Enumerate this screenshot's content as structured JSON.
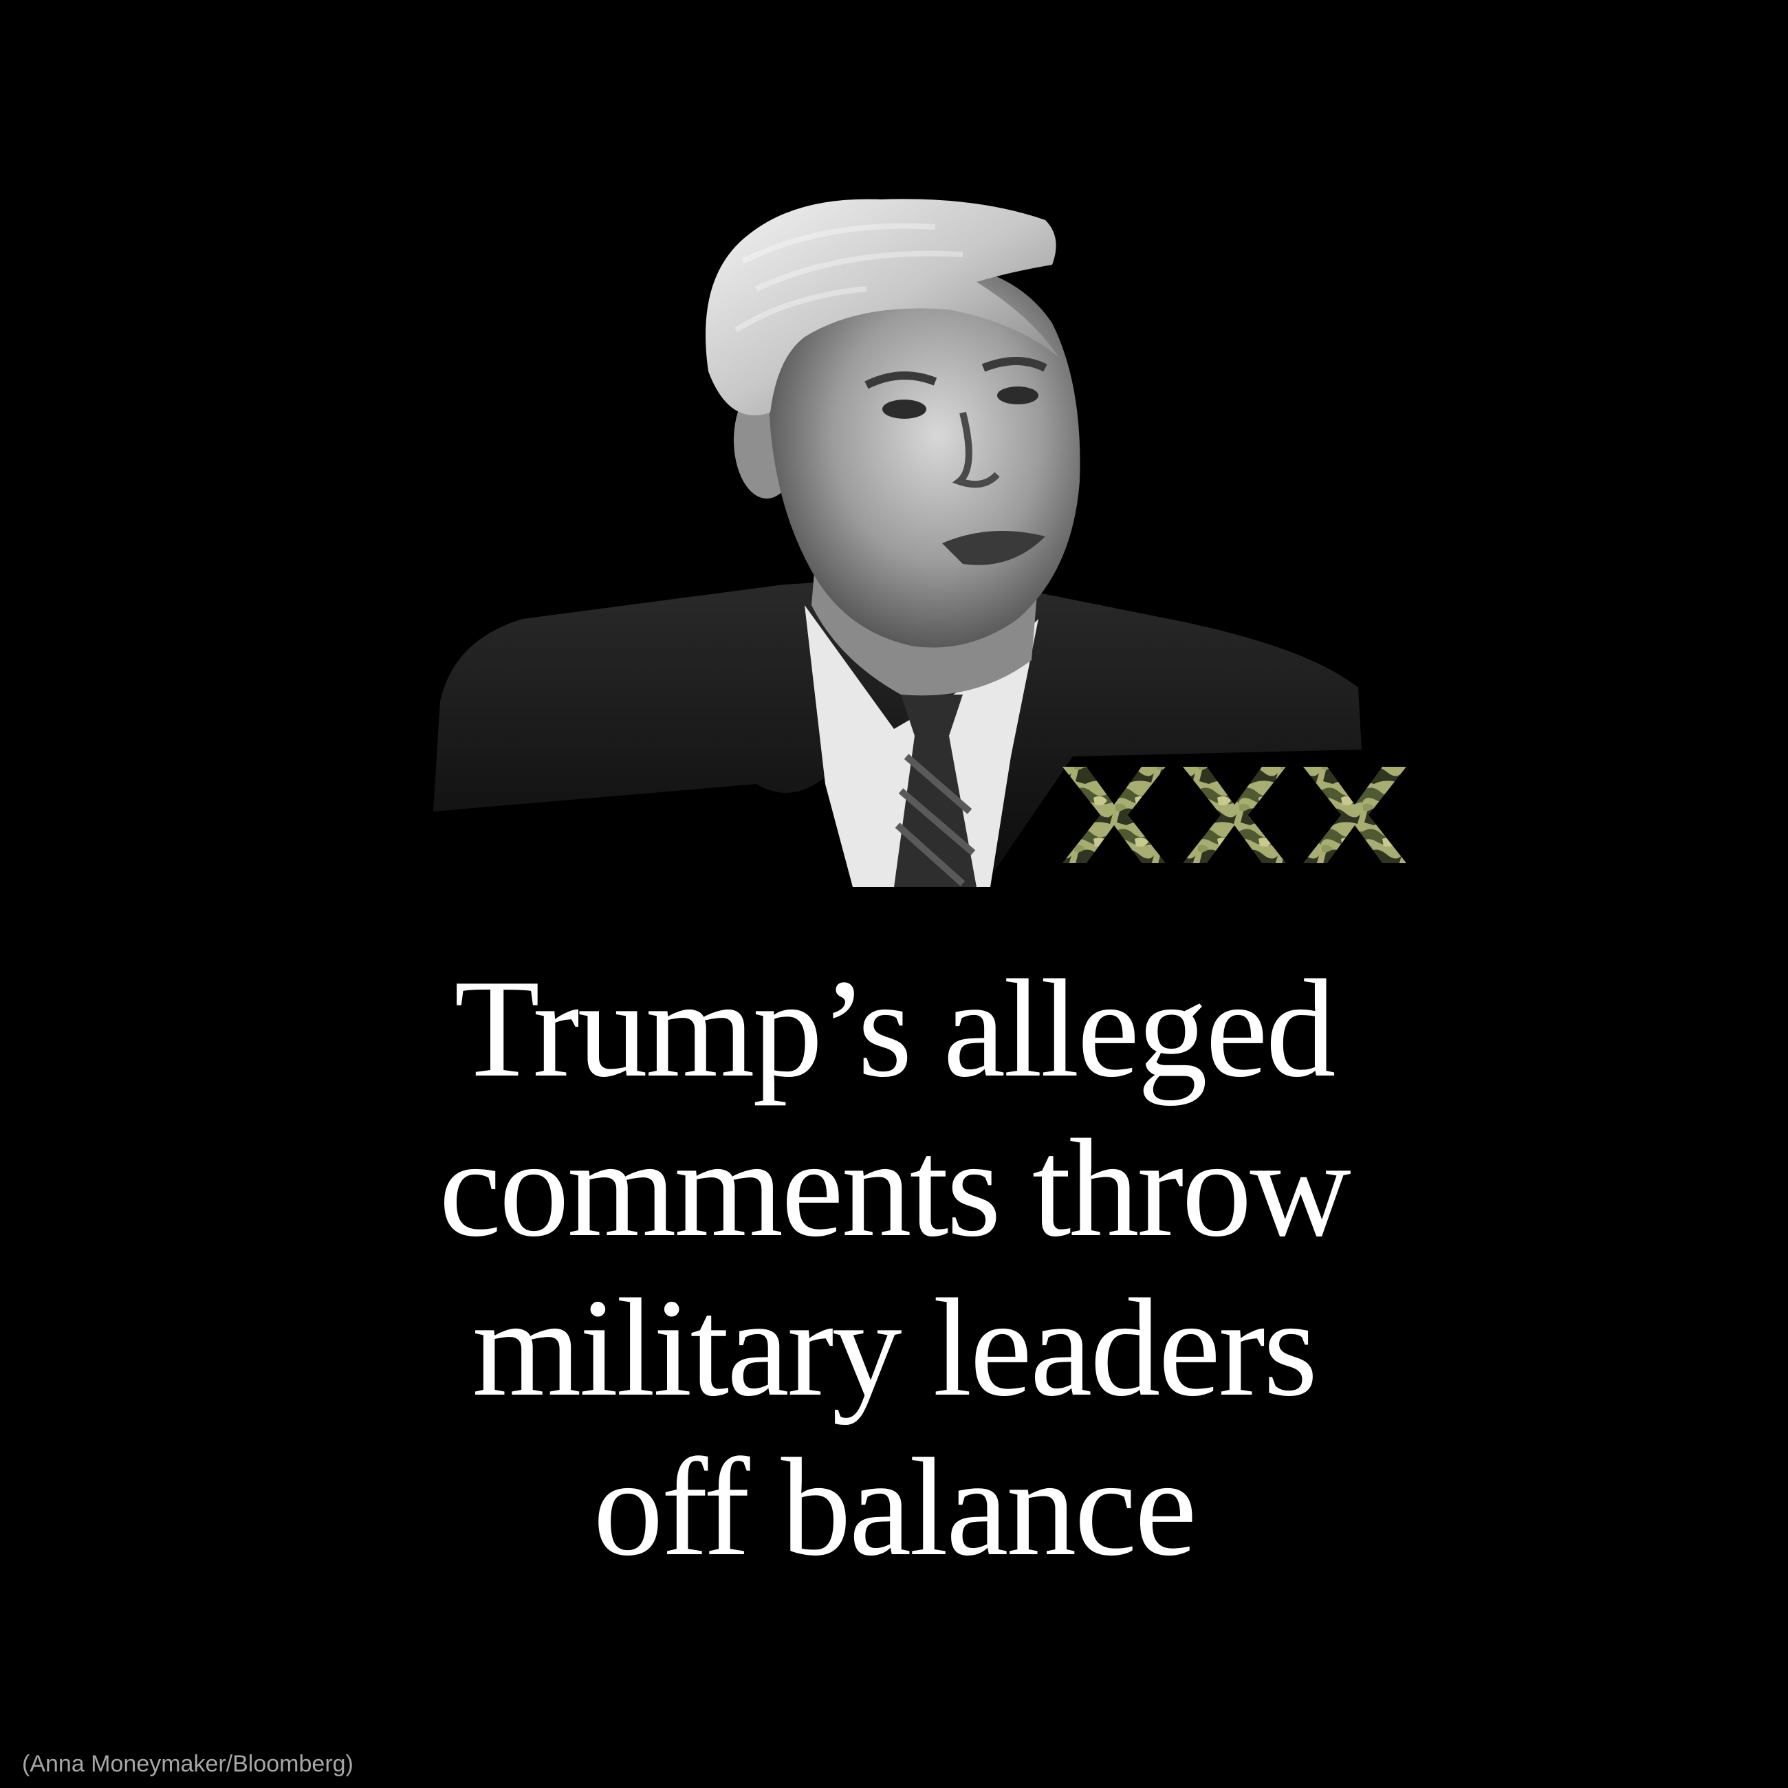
{
  "headline": {
    "lines": [
      "Trump’s alleged",
      "comments throw",
      "military leaders",
      "off balance"
    ]
  },
  "photo": {
    "credit": "(Anna Moneymaker/Bloomberg)",
    "style": "black-and-white cutout portrait"
  },
  "decoration": {
    "icon": "camouflage-x-marks",
    "count": 3,
    "colors": [
      "#8e9a5c",
      "#c9c98f",
      "#4f5a33",
      "#2f3520",
      "#a8ad72"
    ]
  },
  "theme": {
    "background": "#000000",
    "text": "#ffffff"
  }
}
